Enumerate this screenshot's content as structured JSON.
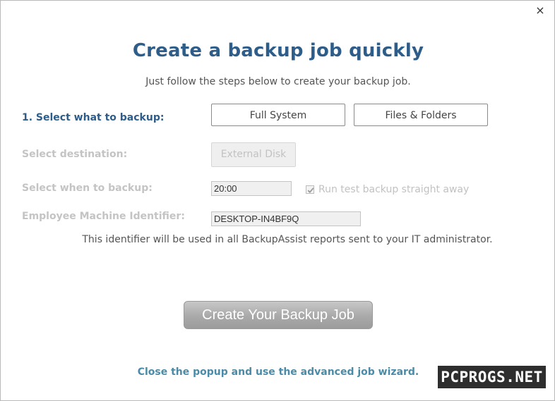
{
  "dialog": {
    "close_icon": "×",
    "title": "Create a backup job quickly",
    "subtitle": "Just follow the steps below to create your backup job."
  },
  "steps": {
    "what": {
      "label": "1. Select what to backup:",
      "options": [
        "Full System",
        "Files & Folders"
      ]
    },
    "destination": {
      "label": "Select destination:",
      "button": "External Disk"
    },
    "when": {
      "label": "Select when to backup:",
      "time": "20:00",
      "run_test_label": "Run test backup straight away",
      "run_test_checked": true
    },
    "identifier": {
      "label": "Employee Machine Identifier:",
      "value": "DESKTOP-IN4BF9Q",
      "note": "This identifier will be used in all BackupAssist reports sent to your IT administrator."
    }
  },
  "actions": {
    "create_label": "Create Your Backup Job",
    "advanced_link": "Close the popup and use the advanced job wizard."
  },
  "watermark": "PCPROGS.NET",
  "colors": {
    "accent": "#2f5d8a",
    "link": "#4b8ba8",
    "disabled_text": "#c4c4c4"
  }
}
